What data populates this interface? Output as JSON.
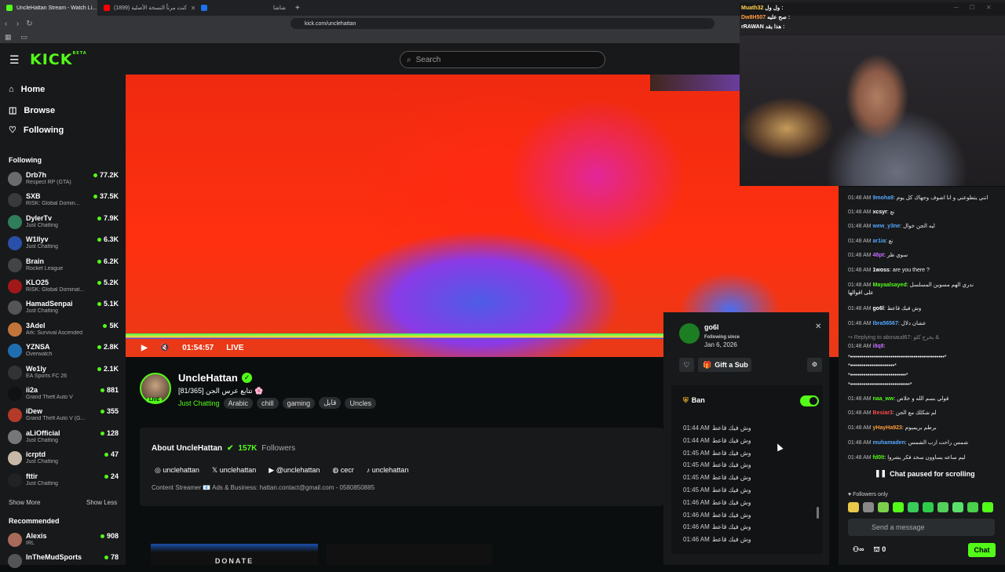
{
  "browser": {
    "tabs": [
      {
        "title": "UncleHattan Stream - Watch Li...",
        "color": "#53fc18",
        "active": true
      },
      {
        "title": "(1899) كنت مرتاً النسخة الأصلية",
        "color": "#ff0000",
        "active": false
      },
      {
        "title": "شاشا",
        "color": "#1a73e8",
        "active": false
      }
    ],
    "new_tab": "+",
    "url": "kick.com/unclehattan"
  },
  "header": {
    "logo": "KICK",
    "logo_sup": "BETA",
    "search_placeholder": "Search"
  },
  "nav": {
    "home": "Home",
    "browse": "Browse",
    "following": "Following"
  },
  "sidebar": {
    "following_title": "Following",
    "following": [
      {
        "name": "Drb7h",
        "game": "Respect RP (GTA)",
        "viewers": "77.2K",
        "color": "#6b6b6b"
      },
      {
        "name": "SXB",
        "game": "RISK: Global Domin...",
        "viewers": "37.5K",
        "color": "#3a3a3a"
      },
      {
        "name": "DylerTv",
        "game": "Just Chatting",
        "viewers": "7.9K",
        "color": "#2f7d5b"
      },
      {
        "name": "W1llyv",
        "game": "Just Chatting",
        "viewers": "6.3K",
        "color": "#2950a8"
      },
      {
        "name": "Brain",
        "game": "Rocket League",
        "viewers": "6.2K",
        "color": "#444"
      },
      {
        "name": "KLO25",
        "game": "RISK: Global Dominat...",
        "viewers": "5.2K",
        "color": "#a01818"
      },
      {
        "name": "HamadSenpai",
        "game": "Just Chatting",
        "viewers": "5.1K",
        "color": "#555"
      },
      {
        "name": "3Adel",
        "game": "Ark: Survival Ascended",
        "viewers": "5K",
        "color": "#c0743a"
      },
      {
        "name": "YZNSA",
        "game": "Overwatch",
        "viewers": "2.8K",
        "color": "#1f6fb0"
      },
      {
        "name": "We1ly",
        "game": "EA Sports FC 26",
        "viewers": "2.1K",
        "color": "#333"
      },
      {
        "name": "ii2a",
        "game": "Grand Theft Auto V",
        "viewers": "881",
        "color": "#111"
      },
      {
        "name": "iDew",
        "game": "Grand Theft Auto V (G...",
        "viewers": "355",
        "color": "#b43a2a"
      },
      {
        "name": "aLiOfficial",
        "game": "Just Chatting",
        "viewers": "128",
        "color": "#777"
      },
      {
        "name": "icrptd",
        "game": "Just Chatting",
        "viewers": "47",
        "color": "#c8b8a8"
      },
      {
        "name": "fttir",
        "game": "Just Chatting",
        "viewers": "24",
        "color": "#222"
      }
    ],
    "show_more": "Show More",
    "show_less": "Show Less",
    "recommended_title": "Recommended",
    "recommended": [
      {
        "name": "Alexis",
        "game": "IRL",
        "viewers": "908",
        "color": "#a86a5a"
      },
      {
        "name": "InTheMudSports",
        "game": "",
        "viewers": "78",
        "color": "#555"
      }
    ]
  },
  "player": {
    "time": "01:54:57",
    "live": "LIVE"
  },
  "channel": {
    "name": "UncleHattan",
    "live_badge": "LIVE",
    "title": "[81/365] تتابع عرس الجن 🌸",
    "category": "Just Chatting",
    "tags": [
      "Arabic",
      "chill",
      "gaming",
      "قايل",
      "Uncles"
    ],
    "about_title": "About UncleHattan",
    "followers": "157K",
    "followers_label": "Followers",
    "socials": [
      {
        "icon": "instagram-icon",
        "label": "unclehattan",
        "glyph": "◎"
      },
      {
        "icon": "x-icon",
        "label": "unclehattan",
        "glyph": "𝕏"
      },
      {
        "icon": "youtube-icon",
        "label": "@unclehattan",
        "glyph": "▶"
      },
      {
        "icon": "discord-icon",
        "label": "cecr",
        "glyph": "◍"
      },
      {
        "icon": "tiktok-icon",
        "label": "unclehattan",
        "glyph": "♪"
      }
    ],
    "bio": "Content Streamer 📧 Ads & Business: hattan.contact@gmail.com - 0580850885",
    "donate": "DONATE"
  },
  "user_popup": {
    "username": "go6l",
    "following_since": "Following since",
    "date": "Jan 6, 2026",
    "gift_sub": "Gift a Sub",
    "ban": "Ban",
    "history": [
      {
        "time": "01:44 AM",
        "text": "وش فيك قاعط"
      },
      {
        "time": "01:44 AM",
        "text": "وش فيك قاعط"
      },
      {
        "time": "01:45 AM",
        "text": "وش فيك قاعط"
      },
      {
        "time": "01:45 AM",
        "text": "وش فيك قاعط"
      },
      {
        "time": "01:45 AM",
        "text": "وش فيك قاعط"
      },
      {
        "time": "01:45 AM",
        "text": "وش فيك قاعط"
      },
      {
        "time": "01:46 AM",
        "text": "وش فيك قاعط"
      },
      {
        "time": "01:46 AM",
        "text": "وش فيك قاعط"
      },
      {
        "time": "01:46 AM",
        "text": "وش فيك قاعط"
      },
      {
        "time": "01:46 AM",
        "text": "وش فيك قاعط"
      }
    ]
  },
  "cam_overlay": [
    {
      "user": "Muath32",
      "text": "ول ول :",
      "color": "#ffd54a"
    },
    {
      "user": "Dw8H507",
      "text": "صح عليه :",
      "color": "#ff9a3a"
    },
    {
      "user": "rRAWAN",
      "text": "هذا يقد :",
      "color": "#ffffff"
    }
  ],
  "chat": {
    "messages": [
      {
        "time": "01:48 AM",
        "user": "9moha9",
        "text": "انني يتطوعني و انا اشوف وجهاك كل يوم",
        "color": "#53a7ff"
      },
      {
        "time": "01:48 AM",
        "user": "xcsyr",
        "text": "نع",
        "color": "#ffffff"
      },
      {
        "time": "01:48 AM",
        "user": "wew_y3ne",
        "text": "ليه الجن خوال",
        "color": "#53a7ff"
      },
      {
        "time": "01:48 AM",
        "user": "ar1ia",
        "text": "نع",
        "color": "#53a7ff"
      },
      {
        "time": "01:48 AM",
        "user": "48pt",
        "text": "سوي ظر",
        "color": "#c56cff"
      },
      {
        "time": "01:48 AM",
        "user": "1woss",
        "text": "are you there ?",
        "color": "#ffffff"
      },
      {
        "time": "01:48 AM",
        "user": "Mayaalsayed",
        "text": "ندري الهم مسوين المسلسل",
        "color": "#53fc18"
      },
      {
        "time": "",
        "user": "",
        "text": "على اقوالها",
        "color": "#ffffff"
      },
      {
        "time": "01:48 AM",
        "user": "go6l",
        "text": "وش فيك قاعط",
        "color": "#ffffff"
      },
      {
        "time": "01:48 AM",
        "user": "Ibra56567",
        "text": "عشان دلال",
        "color": "#53a7ff"
      },
      {
        "time": "",
        "user": "",
        "text": "↪ Replying to abosaud67: يخرج كلو  &",
        "color": "#888888"
      },
      {
        "time": "01:48 AM",
        "user": "i8q8",
        "text": "",
        "color": "#c56cff"
      },
      {
        "time": "",
        "user": "",
        "text": "*•••••••••••••••••••••••••••••••••••••••••••••••••*",
        "color": "#ffffff"
      },
      {
        "time": "",
        "user": "",
        "text": "*•••••••••••••••••••••••*",
        "color": "#ffffff"
      },
      {
        "time": "",
        "user": "",
        "text": "*•••••••••••••••••••••••••••••*",
        "color": "#ffffff"
      },
      {
        "time": "",
        "user": "",
        "text": "*•••••••••••••••••••••••••••••••*",
        "color": "#ffffff"
      },
      {
        "time": "01:48 AM",
        "user": "naa_ww",
        "text": "قولي بسم الله و خلاص",
        "color": "#53fc18"
      },
      {
        "time": "01:48 AM",
        "user": "Besiar3",
        "text": "لم شكلك مع الجن",
        "color": "#ff4a4a"
      },
      {
        "time": "01:48 AM",
        "user": "yHayHa923",
        "text": "برطم بريميوم",
        "color": "#ff9a3a"
      },
      {
        "time": "01:48 AM",
        "user": "muhamaden",
        "text": "شمس راحت ارب الشمس",
        "color": "#53a7ff"
      },
      {
        "time": "01:48 AM",
        "user": "fd0lt",
        "text": "ليم ساعه يساوون سحد فكر يشروا",
        "color": "#53fc18"
      }
    ],
    "paused": "Chat paused for scrolling",
    "followers_only": "Followers only",
    "input_placeholder": "Send a message",
    "points": "0",
    "chat_button": "Chat"
  }
}
